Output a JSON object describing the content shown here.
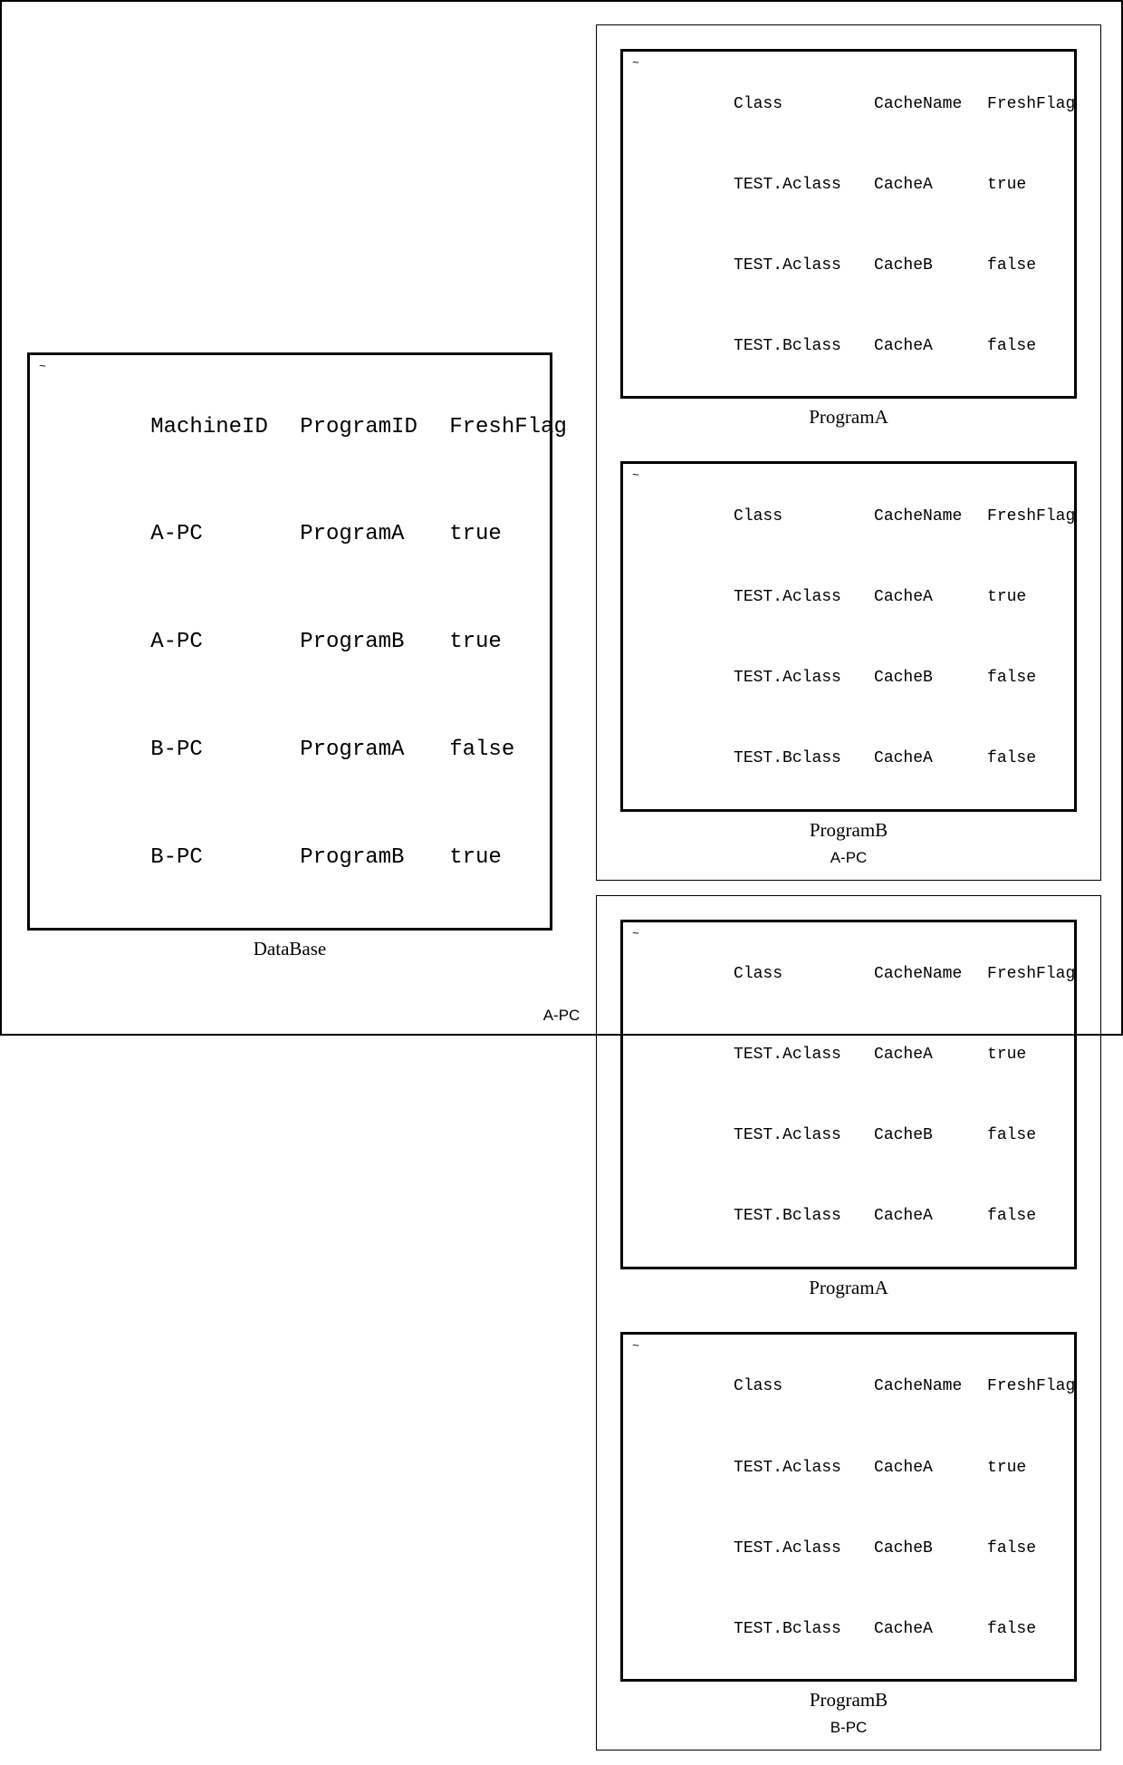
{
  "outer_label": "A-PC",
  "database": {
    "label": "DataBase",
    "headers": [
      "MachineID",
      "ProgramID",
      "FreshFlag"
    ],
    "rows": [
      [
        "A-PC",
        "ProgramA",
        "true"
      ],
      [
        "A-PC",
        "ProgramB",
        "true"
      ],
      [
        "B-PC",
        "ProgramA",
        "false"
      ],
      [
        "B-PC",
        "ProgramB",
        "true"
      ]
    ]
  },
  "cache_headers": [
    "Class",
    "CacheName",
    "FreshFlag"
  ],
  "cache_rows": [
    [
      "TEST.Aclass",
      "CacheA",
      "true"
    ],
    [
      "TEST.Aclass",
      "CacheB",
      "false"
    ],
    [
      "TEST.Bclass",
      "CacheA",
      "false"
    ]
  ],
  "pcs": [
    {
      "label": "A-PC",
      "programs": [
        {
          "label": "ProgramA"
        },
        {
          "label": "ProgramB"
        }
      ]
    },
    {
      "label": "B-PC",
      "programs": [
        {
          "label": "ProgramA"
        },
        {
          "label": "ProgramB"
        }
      ]
    }
  ]
}
